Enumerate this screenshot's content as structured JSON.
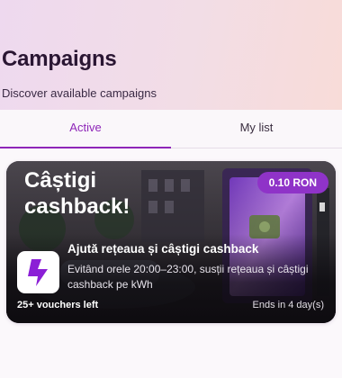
{
  "header": {
    "title": "Campaigns",
    "subtitle": "Discover available campaigns"
  },
  "tabs": [
    {
      "label": "Active",
      "selected": true
    },
    {
      "label": "My list",
      "selected": false
    }
  ],
  "colors": {
    "accent": "#8e26b8",
    "badge": "#8f33c8",
    "logo_bolt": "#8b1fd6"
  },
  "campaign": {
    "promo_title": "Câștigi cashback!",
    "price_badge": "0.10 RON",
    "title": "Ajută rețeaua și câștigi cashback",
    "description": "Evitând orele 20:00–23:00, susții rețeaua și câștigi cashback pe kWh",
    "vouchers_left": "25+ vouchers left",
    "ends_in": "Ends in 4 day(s)",
    "logo_icon": "lightning-bolt-icon"
  }
}
